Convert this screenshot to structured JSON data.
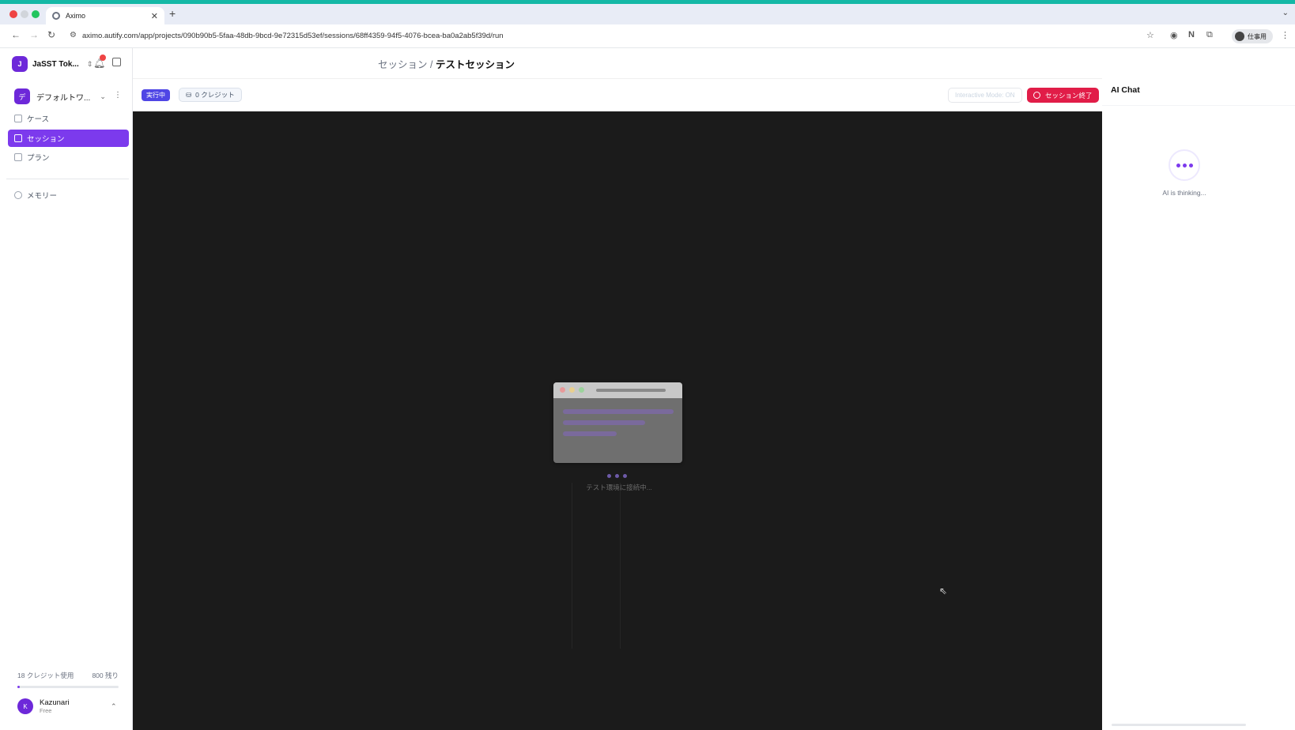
{
  "browser": {
    "tab_title": "Aximo",
    "url": "aximo.autify.com/app/projects/090b90b5-5faa-48db-9bcd-9e72315d53ef/sessions/68ff4359-94f5-4076-bcea-ba0a2ab5f39d/run",
    "profile_label": "仕事用"
  },
  "sidebar": {
    "workspace_initial": "J",
    "workspace_name": "JaSST Tok...",
    "project_initial": "デ",
    "project_name": "デフォルトワ...",
    "items": [
      {
        "label": "ケース"
      },
      {
        "label": "セッション"
      },
      {
        "label": "プラン"
      },
      {
        "label": "メモリー"
      }
    ],
    "credits_used": "18 クレジット使用",
    "credits_left": "800 残り",
    "credits_fraction": 0.022,
    "user_initial": "K",
    "user_name": "Kazunari",
    "user_plan": "Free"
  },
  "main": {
    "breadcrumb_parent": "セッション",
    "breadcrumb_sep": "/",
    "breadcrumb_current": "テストセッション",
    "status_badge": "実行中",
    "credits_button": "0 クレジット",
    "interactive_mode": "Interactive Mode: ON",
    "end_session": "セッション終了",
    "loading_text": "テスト環境に接続中..."
  },
  "chat": {
    "title": "AI Chat",
    "thinking_text": "AI is thinking..."
  },
  "colors": {
    "accent": "#7c3aed",
    "status_blue": "#4f46e5",
    "danger": "#e11d48",
    "top_line": "#14b8a6"
  }
}
